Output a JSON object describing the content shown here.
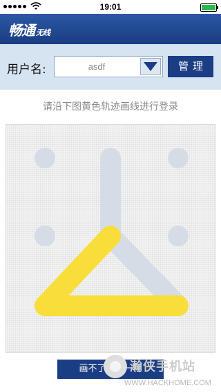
{
  "status_bar": {
    "time": "19:01",
    "signal_icon": "signal-dots-icon",
    "wifi_icon": "wifi-icon",
    "battery_icon": "battery-icon",
    "battery_color": "#2db84d"
  },
  "header": {
    "logo_main": "畅通",
    "logo_sub": "无线",
    "background": "#1f4690"
  },
  "login": {
    "username_label": "用户名:",
    "username_value": "asdf",
    "dropdown_icon": "triangle-down-icon",
    "manage_label": "管理"
  },
  "pattern": {
    "hint": "请沿下图黄色轨迹画线进行登录",
    "trace_color": "#f9dd3a",
    "grid_color": "#d6dce6"
  },
  "actions": {
    "change_label": "画不了，换一种"
  },
  "watermark": {
    "title": "瀚侠手机站",
    "url": "WWW.HACKHOME.COM"
  }
}
